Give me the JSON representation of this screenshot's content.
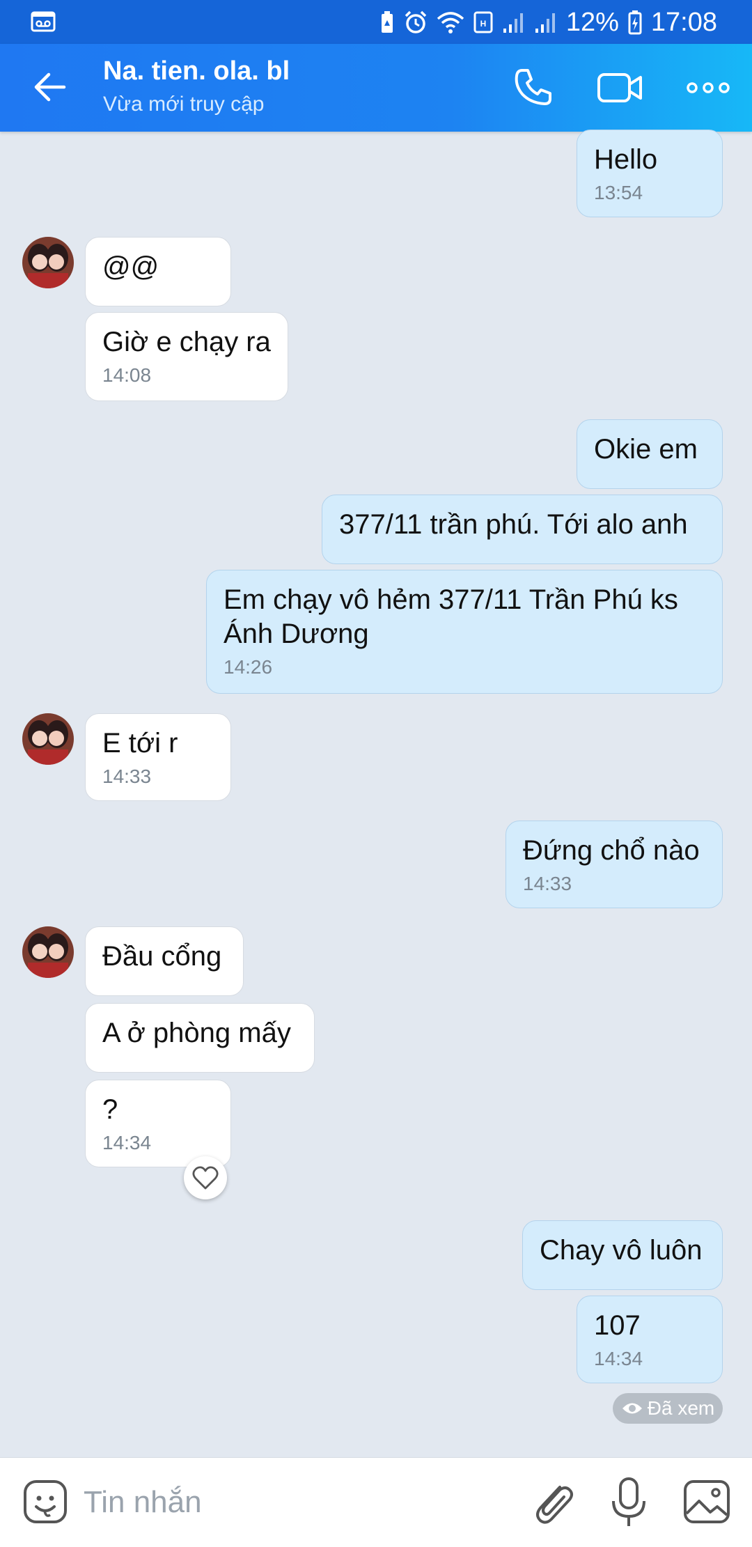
{
  "status_bar": {
    "battery_percent": "12%",
    "time": "17:08",
    "icons": [
      "voicemail-icon",
      "battery-saver-icon",
      "alarm-icon",
      "wifi-icon",
      "hd-icon",
      "signal-icon",
      "signal-icon",
      "battery-icon"
    ]
  },
  "header": {
    "title": "Na. tien. ola. bl",
    "subtitle": "Vừa mới truy cập",
    "colors": {
      "gradient_start": "#1f78f2",
      "gradient_end": "#17b8f7"
    }
  },
  "messages": [
    {
      "dir": "out",
      "text": "Hello",
      "time": "13:54"
    },
    {
      "dir": "in",
      "text": "@@",
      "time": ""
    },
    {
      "dir": "in",
      "text": "Giờ e chạy ra",
      "time": "14:08"
    },
    {
      "dir": "out",
      "text": "Okie em",
      "time": ""
    },
    {
      "dir": "out",
      "text": "377/11 trần phú. Tới alo anh",
      "time": ""
    },
    {
      "dir": "out",
      "text_line1": "Em chạy vô hẻm 377/11 Trần Phú ks",
      "text_line2": "Ánh Dương",
      "time": "14:26"
    },
    {
      "dir": "in",
      "text": "E tới r",
      "time": "14:33"
    },
    {
      "dir": "out",
      "text": "Đứng chổ nào",
      "time": "14:33"
    },
    {
      "dir": "in",
      "text": "Đầu cổng",
      "time": ""
    },
    {
      "dir": "in",
      "text": "A ở phòng mấy",
      "time": ""
    },
    {
      "dir": "in",
      "text": "?",
      "time": "14:34"
    },
    {
      "dir": "out",
      "text": "Chay vô luôn",
      "time": ""
    },
    {
      "dir": "out",
      "text": "107",
      "time": "14:34"
    }
  ],
  "seen_label": "Đã xem",
  "input": {
    "placeholder": "Tin nhắn"
  },
  "colors": {
    "outgoing_bubble": "#d4ecfc",
    "incoming_bubble": "#ffffff",
    "chat_background": "#e2e8f0"
  }
}
